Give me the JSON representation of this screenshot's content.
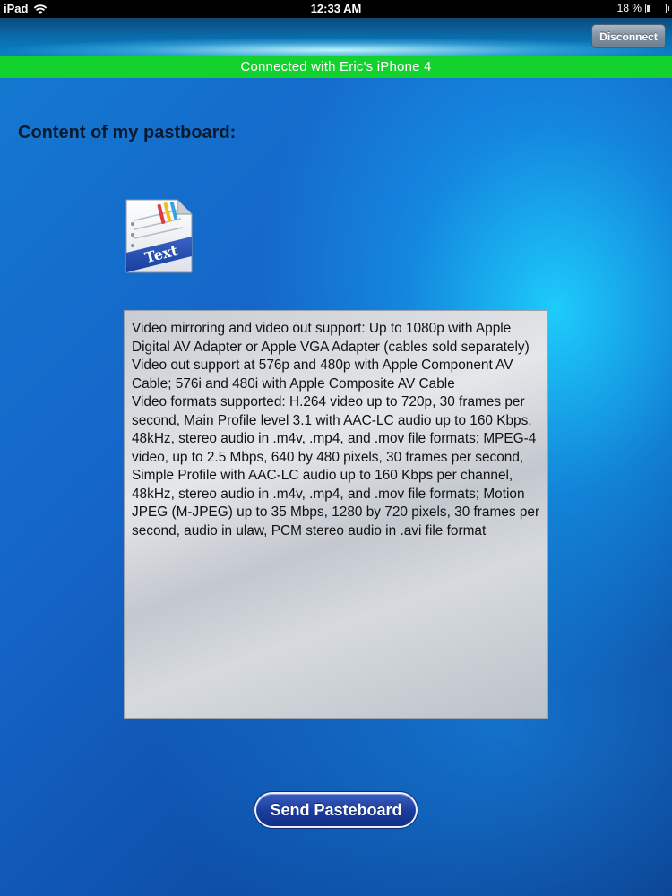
{
  "status_bar": {
    "device": "iPad",
    "time": "12:33 AM",
    "battery_percent": "18 %",
    "battery_level": 0.18
  },
  "toolbar": {
    "disconnect_label": "Disconnect"
  },
  "connection": {
    "message": "Connected with Eric's iPhone 4",
    "color": "#14d22e"
  },
  "pasteboard": {
    "title": "Content of my pastboard:",
    "icon": "text-document-icon",
    "icon_label": "Text",
    "content": "Video mirroring and video out support: Up to 1080p with Apple Digital AV Adapter or Apple VGA Adapter (cables sold separately)\nVideo out support at 576p and 480p with Apple Component AV Cable; 576i and 480i with Apple Composite AV Cable\nVideo formats supported: H.264 video up to 720p, 30 frames per second, Main Profile level 3.1 with AAC-LC audio up to 160 Kbps, 48kHz, stereo audio in .m4v, .mp4, and .mov file formats; MPEG-4 video, up to 2.5 Mbps, 640 by 480 pixels, 30 frames per second, Simple Profile with AAC-LC audio up to 160 Kbps per channel, 48kHz, stereo audio in .m4v, .mp4, and .mov file formats; Motion JPEG (M-JPEG) up to 35 Mbps, 1280 by 720 pixels, 30 frames per second, audio in ulaw, PCM stereo audio in .avi file format"
  },
  "actions": {
    "send_label": "Send Pasteboard"
  }
}
